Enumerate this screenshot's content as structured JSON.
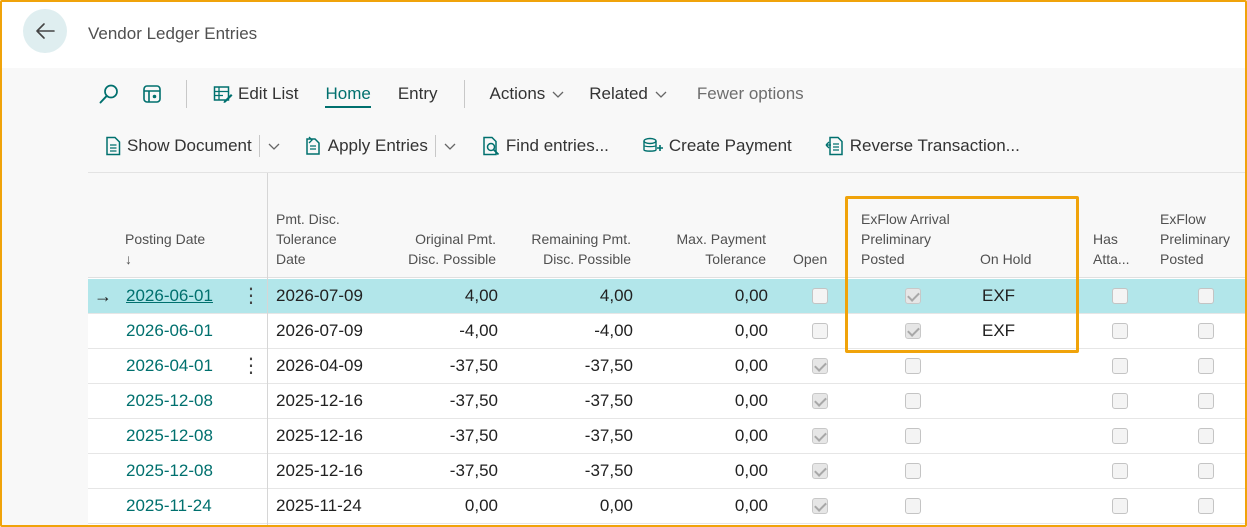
{
  "page": {
    "title": "Vendor Ledger Entries"
  },
  "colors": {
    "accent": "#00706e",
    "selected_row": "#b2e6ea",
    "highlight": "#f0a30a"
  },
  "actionbar1": {
    "search_icon": "search-icon",
    "filter_icon": "filter-pane-icon",
    "edit_list": "Edit List",
    "home": "Home",
    "entry": "Entry",
    "actions": "Actions",
    "related": "Related",
    "fewer_options": "Fewer options"
  },
  "actionbar2": {
    "show_document": "Show Document",
    "apply_entries": "Apply Entries",
    "find_entries": "Find entries...",
    "create_payment": "Create Payment",
    "reverse_transaction": "Reverse Transaction..."
  },
  "columns": {
    "posting_date": "Posting Date",
    "sort_arrow": "↓",
    "pmt_disc_tol_date_1": "Pmt. Disc.",
    "pmt_disc_tol_date_2": "Tolerance",
    "pmt_disc_tol_date_3": "Date",
    "orig_pmt_1": "Original Pmt.",
    "orig_pmt_2": "Disc. Possible",
    "rem_pmt_1": "Remaining Pmt.",
    "rem_pmt_2": "Disc. Possible",
    "max_pay_1": "Max. Payment",
    "max_pay_2": "Tolerance",
    "open": "Open",
    "exflow_arrival_1": "ExFlow Arrival",
    "exflow_arrival_2": "Preliminary",
    "exflow_arrival_3": "Posted",
    "on_hold": "On Hold",
    "has_att_1": "Has",
    "has_att_2": "Atta...",
    "exflow_prelim_1": "ExFlow",
    "exflow_prelim_2": "Preliminary",
    "exflow_prelim_3": "Posted"
  },
  "rows": [
    {
      "posting_date": "2026-06-01",
      "tol_date": "2026-07-09",
      "orig": "4,00",
      "rem": "4,00",
      "max": "0,00",
      "open": false,
      "arrival": true,
      "on_hold": "EXF",
      "has_att": false,
      "prelim": false
    },
    {
      "posting_date": "2026-06-01",
      "tol_date": "2026-07-09",
      "orig": "-4,00",
      "rem": "-4,00",
      "max": "0,00",
      "open": false,
      "arrival": true,
      "on_hold": "EXF",
      "has_att": false,
      "prelim": false
    },
    {
      "posting_date": "2026-04-01",
      "tol_date": "2026-04-09",
      "orig": "-37,50",
      "rem": "-37,50",
      "max": "0,00",
      "open": true,
      "arrival": false,
      "on_hold": "",
      "has_att": false,
      "prelim": false
    },
    {
      "posting_date": "2025-12-08",
      "tol_date": "2025-12-16",
      "orig": "-37,50",
      "rem": "-37,50",
      "max": "0,00",
      "open": true,
      "arrival": false,
      "on_hold": "",
      "has_att": false,
      "prelim": false
    },
    {
      "posting_date": "2025-12-08",
      "tol_date": "2025-12-16",
      "orig": "-37,50",
      "rem": "-37,50",
      "max": "0,00",
      "open": true,
      "arrival": false,
      "on_hold": "",
      "has_att": false,
      "prelim": false
    },
    {
      "posting_date": "2025-12-08",
      "tol_date": "2025-12-16",
      "orig": "-37,50",
      "rem": "-37,50",
      "max": "0,00",
      "open": true,
      "arrival": false,
      "on_hold": "",
      "has_att": false,
      "prelim": false
    },
    {
      "posting_date": "2025-11-24",
      "tol_date": "2025-11-24",
      "orig": "0,00",
      "rem": "0,00",
      "max": "0,00",
      "open": true,
      "arrival": false,
      "on_hold": "",
      "has_att": false,
      "prelim": false
    }
  ]
}
